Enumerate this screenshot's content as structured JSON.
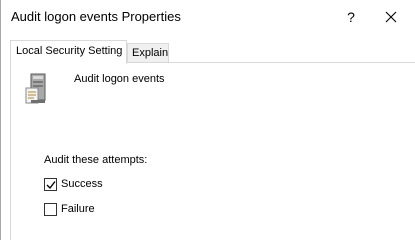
{
  "window": {
    "title": "Audit logon events Properties",
    "help_label": "?",
    "close_icon": "close-icon"
  },
  "tabs": [
    {
      "label": "Local Security Setting",
      "active": true
    },
    {
      "label": "Explain",
      "active": false
    }
  ],
  "policy": {
    "icon": "server-policy-icon",
    "name": "Audit logon events"
  },
  "audit": {
    "label": "Audit these attempts:",
    "options": [
      {
        "label": "Success",
        "checked": true
      },
      {
        "label": "Failure",
        "checked": false
      }
    ]
  }
}
